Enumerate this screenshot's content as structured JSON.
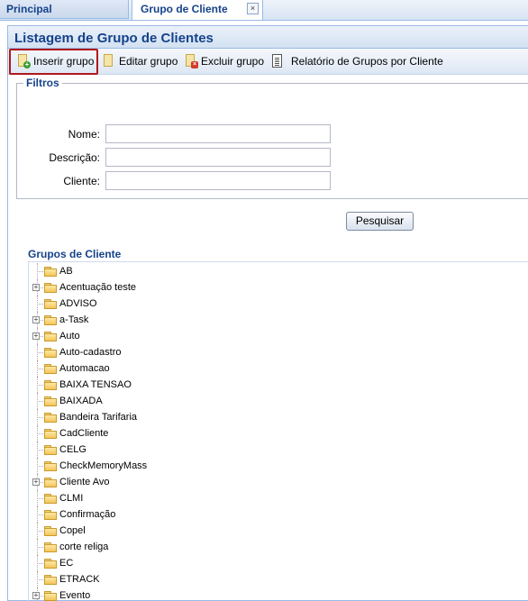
{
  "tabs": [
    {
      "label": "Principal"
    },
    {
      "label": "Grupo de Cliente",
      "close": "×"
    }
  ],
  "panel": {
    "title": "Listagem de Grupo de Clientes"
  },
  "toolbar": {
    "insert_label": "Inserir grupo",
    "edit_label": "Editar grupo",
    "delete_label": "Excluir grupo",
    "report_label": "Relatório de Grupos por Cliente"
  },
  "filters": {
    "legend": "Filtros",
    "name_label": "Nome:",
    "name_value": "",
    "description_label": "Descrição:",
    "description_value": "",
    "client_label": "Cliente:",
    "client_value": "",
    "search_button": "Pesquisar"
  },
  "tree": {
    "title": "Grupos de Cliente",
    "items": [
      {
        "label": "AB",
        "expandable": false
      },
      {
        "label": "Acentuação teste",
        "expandable": true
      },
      {
        "label": "ADVISO",
        "expandable": false
      },
      {
        "label": "a-Task",
        "expandable": true
      },
      {
        "label": "Auto",
        "expandable": true
      },
      {
        "label": "Auto-cadastro",
        "expandable": false
      },
      {
        "label": "Automacao",
        "expandable": false
      },
      {
        "label": "BAIXA TENSAO",
        "expandable": false
      },
      {
        "label": "BAIXADA",
        "expandable": false
      },
      {
        "label": "Bandeira Tarifaria",
        "expandable": false
      },
      {
        "label": "CadCliente",
        "expandable": false
      },
      {
        "label": "CELG",
        "expandable": false
      },
      {
        "label": "CheckMemoryMass",
        "expandable": false
      },
      {
        "label": "Cliente Avo",
        "expandable": true
      },
      {
        "label": "CLMI",
        "expandable": false
      },
      {
        "label": "Confirmação",
        "expandable": false
      },
      {
        "label": "Copel",
        "expandable": false
      },
      {
        "label": "corte religa",
        "expandable": false
      },
      {
        "label": "EC",
        "expandable": false
      },
      {
        "label": "ETRACK",
        "expandable": false
      },
      {
        "label": "Evento",
        "expandable": true
      }
    ]
  },
  "colors": {
    "accent": "#15428b",
    "highlight": "#b0191c",
    "border": "#99bbe8"
  },
  "icons": {
    "insert": "add-document-icon",
    "edit": "edit-document-icon",
    "delete": "delete-document-icon",
    "report": "report-icon",
    "folder": "folder-icon",
    "expand": "plus-expander-icon"
  }
}
